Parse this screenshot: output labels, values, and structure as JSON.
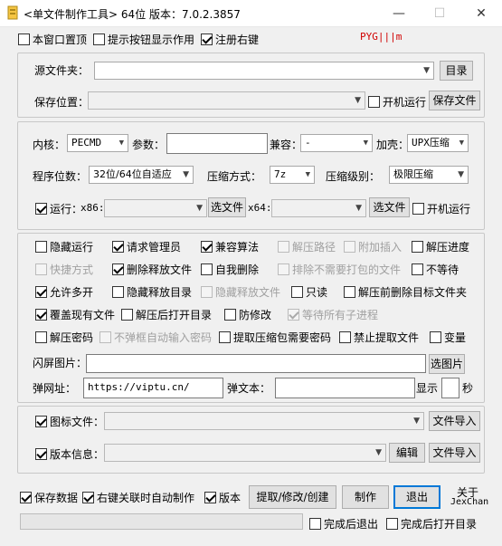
{
  "window": {
    "title": "<单文件制作工具> 64位 版本：7.0.2.3857",
    "min_symbol": "—",
    "max_symbol": "☐",
    "close_symbol": "✕"
  },
  "top_options": {
    "topmost": {
      "label": "本窗口置顶",
      "checked": false
    },
    "show_tips": {
      "label": "提示按钮显示作用",
      "checked": false
    },
    "register_menu": {
      "label": "注册右键",
      "checked": true
    },
    "tag": "PYG|||m"
  },
  "source": {
    "label": "源文件夹：",
    "value": "",
    "dir_button": "目录",
    "save_label": "保存位置：",
    "save_value": "",
    "autostart": {
      "label": "开机运行",
      "checked": false
    },
    "save_button": "保存文件"
  },
  "core": {
    "kernel_label": "内核：",
    "kernel_value": "PECMD",
    "params_label": "参数：",
    "params_value": "",
    "compat_label": "兼容：",
    "compat_value": "-",
    "shell_label": "加壳：",
    "shell_value": "UPX压缩",
    "bits_label": "程序位数：",
    "bits_value": "32位/64位自适应",
    "method_label": "压缩方式：",
    "method_value": "7z",
    "level_label": "压缩级别：",
    "level_value": "极限压缩",
    "run": {
      "label": "运行：",
      "checked": true
    },
    "x86_label": "x86:",
    "x86_value": "",
    "x86_button": "选文件",
    "x64_label": "x64:",
    "x64_value": "",
    "x64_button": "选文件",
    "run_autostart": {
      "label": "开机运行",
      "checked": false
    }
  },
  "options": {
    "hide_run": {
      "label": "隐藏运行",
      "checked": false,
      "enabled": true
    },
    "request_admin": {
      "label": "请求管理员",
      "checked": true,
      "enabled": true
    },
    "compat_algo": {
      "label": "兼容算法",
      "checked": true,
      "enabled": true
    },
    "extract_path": {
      "label": "解压路径",
      "checked": false,
      "enabled": false
    },
    "append_insert": {
      "label": "附加插入",
      "checked": false,
      "enabled": false
    },
    "extract_progress": {
      "label": "解压进度",
      "checked": false,
      "enabled": true
    },
    "shortcut": {
      "label": "快捷方式",
      "checked": false,
      "enabled": false
    },
    "delete_released": {
      "label": "删除释放文件",
      "checked": true,
      "enabled": true
    },
    "self_delete": {
      "label": "自我删除",
      "checked": false,
      "enabled": true
    },
    "exclude_children": {
      "label": "排除不需要打包的文件",
      "checked": false,
      "enabled": false
    },
    "no_wait": {
      "label": "不等待",
      "checked": false,
      "enabled": true
    },
    "allow_multi": {
      "label": "允许多开",
      "checked": true,
      "enabled": true
    },
    "hide_release_dir": {
      "label": "隐藏释放目录",
      "checked": false,
      "enabled": true
    },
    "hide_release_file": {
      "label": "隐藏释放文件",
      "checked": false,
      "enabled": false
    },
    "readonly": {
      "label": "只读",
      "checked": false,
      "enabled": true
    },
    "delete_before": {
      "label": "解压前删除目标文件夹",
      "checked": false,
      "enabled": true
    },
    "overwrite": {
      "label": "覆盖现有文件",
      "checked": true,
      "enabled": true
    },
    "open_dir_after": {
      "label": "解压后打开目录",
      "checked": false,
      "enabled": true
    },
    "anti_modify": {
      "label": "防修改",
      "checked": false,
      "enabled": true
    },
    "wait_children": {
      "label": "等待所有子进程",
      "checked": true,
      "enabled": false
    },
    "extract_password": {
      "label": "解压密码",
      "checked": false,
      "enabled": true
    },
    "no_popup_password": {
      "label": "不弹框自动输入密码",
      "checked": false,
      "enabled": false
    },
    "need_password": {
      "label": "提取压缩包需要密码",
      "checked": false,
      "enabled": true
    },
    "forbid_extract": {
      "label": "禁止提取文件",
      "checked": false,
      "enabled": true
    },
    "variables": {
      "label": "变量",
      "checked": false,
      "enabled": true
    },
    "splash_label": "闪屏图片：",
    "splash_value": "",
    "splash_button": "选图片",
    "popup_url_label": "弹网址：",
    "popup_url_value": "https://viptu.cn/",
    "popup_text_label": "弹文本：",
    "popup_text_value": "",
    "show_label": "显示",
    "show_value": "",
    "seconds_label": "秒"
  },
  "resources": {
    "icon": {
      "label": "图标文件：",
      "checked": true
    },
    "icon_value": "",
    "icon_button": "文件导入",
    "version": {
      "label": "版本信息：",
      "checked": true
    },
    "version_value": "",
    "edit_button": "编辑",
    "version_button": "文件导入"
  },
  "bottom": {
    "save_data": {
      "label": "保存数据",
      "checked": true
    },
    "right_click_auto": {
      "label": "右键关联时自动制作",
      "checked": true
    },
    "version": {
      "label": "版本",
      "checked": true
    },
    "extract_button": "提取/修改/创建",
    "make_button": "制作",
    "exit_button": "退出",
    "about_label": "关于",
    "author": "JexChan",
    "exit_after": {
      "label": "完成后退出",
      "checked": false
    },
    "open_after": {
      "label": "完成后打开目录",
      "checked": false
    }
  }
}
